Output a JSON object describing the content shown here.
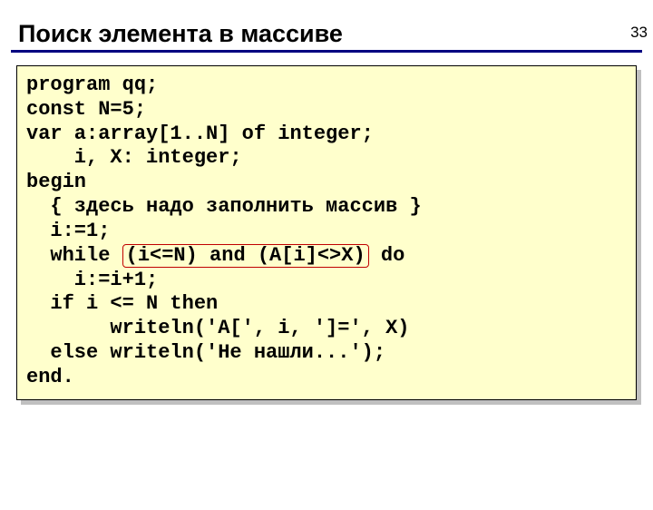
{
  "page_number": "33",
  "title": "Поиск элемента в массиве",
  "code": {
    "l1": "program qq;",
    "l2": "const N=5;",
    "l3": "var a:array[1..N] of integer;",
    "l4": "    i, X: integer;",
    "l5": "begin",
    "l6": "  { здесь надо заполнить массив }",
    "l7": "  i:=1;",
    "l8a": "  while ",
    "l8h": "(i<=N) and (A[i]<>X)",
    "l8b": " do",
    "l9": "    i:=i+1;",
    "l10": "  if i <= N then",
    "l11": "       writeln('A[', i, ']=', X)",
    "l12": "  else writeln('Не нашли...');",
    "l13": "end."
  }
}
